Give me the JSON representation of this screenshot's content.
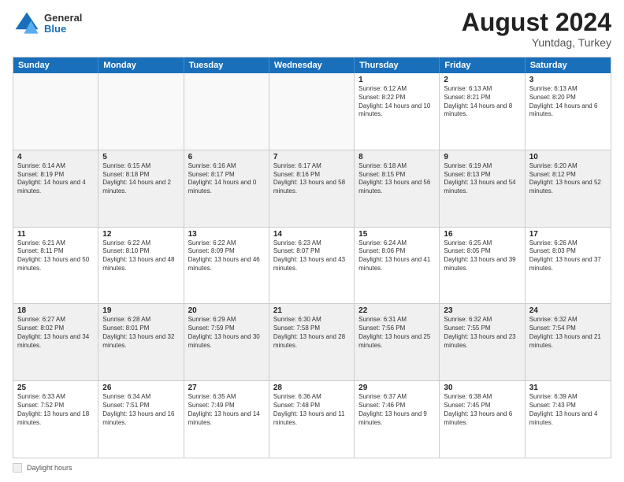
{
  "logo": {
    "general": "General",
    "blue": "Blue"
  },
  "header": {
    "month_year": "August 2024",
    "location": "Yuntdag, Turkey"
  },
  "day_headers": [
    "Sunday",
    "Monday",
    "Tuesday",
    "Wednesday",
    "Thursday",
    "Friday",
    "Saturday"
  ],
  "weeks": [
    [
      {
        "date": "",
        "info": "",
        "empty": true
      },
      {
        "date": "",
        "info": "",
        "empty": true
      },
      {
        "date": "",
        "info": "",
        "empty": true
      },
      {
        "date": "",
        "info": "",
        "empty": true
      },
      {
        "date": "1",
        "info": "Sunrise: 6:12 AM\nSunset: 8:22 PM\nDaylight: 14 hours and 10 minutes.",
        "empty": false
      },
      {
        "date": "2",
        "info": "Sunrise: 6:13 AM\nSunset: 8:21 PM\nDaylight: 14 hours and 8 minutes.",
        "empty": false
      },
      {
        "date": "3",
        "info": "Sunrise: 6:13 AM\nSunset: 8:20 PM\nDaylight: 14 hours and 6 minutes.",
        "empty": false
      }
    ],
    [
      {
        "date": "4",
        "info": "Sunrise: 6:14 AM\nSunset: 8:19 PM\nDaylight: 14 hours and 4 minutes.",
        "empty": false,
        "shaded": true
      },
      {
        "date": "5",
        "info": "Sunrise: 6:15 AM\nSunset: 8:18 PM\nDaylight: 14 hours and 2 minutes.",
        "empty": false,
        "shaded": true
      },
      {
        "date": "6",
        "info": "Sunrise: 6:16 AM\nSunset: 8:17 PM\nDaylight: 14 hours and 0 minutes.",
        "empty": false,
        "shaded": true
      },
      {
        "date": "7",
        "info": "Sunrise: 6:17 AM\nSunset: 8:16 PM\nDaylight: 13 hours and 58 minutes.",
        "empty": false,
        "shaded": true
      },
      {
        "date": "8",
        "info": "Sunrise: 6:18 AM\nSunset: 8:15 PM\nDaylight: 13 hours and 56 minutes.",
        "empty": false,
        "shaded": true
      },
      {
        "date": "9",
        "info": "Sunrise: 6:19 AM\nSunset: 8:13 PM\nDaylight: 13 hours and 54 minutes.",
        "empty": false,
        "shaded": true
      },
      {
        "date": "10",
        "info": "Sunrise: 6:20 AM\nSunset: 8:12 PM\nDaylight: 13 hours and 52 minutes.",
        "empty": false,
        "shaded": true
      }
    ],
    [
      {
        "date": "11",
        "info": "Sunrise: 6:21 AM\nSunset: 8:11 PM\nDaylight: 13 hours and 50 minutes.",
        "empty": false
      },
      {
        "date": "12",
        "info": "Sunrise: 6:22 AM\nSunset: 8:10 PM\nDaylight: 13 hours and 48 minutes.",
        "empty": false
      },
      {
        "date": "13",
        "info": "Sunrise: 6:22 AM\nSunset: 8:09 PM\nDaylight: 13 hours and 46 minutes.",
        "empty": false
      },
      {
        "date": "14",
        "info": "Sunrise: 6:23 AM\nSunset: 8:07 PM\nDaylight: 13 hours and 43 minutes.",
        "empty": false
      },
      {
        "date": "15",
        "info": "Sunrise: 6:24 AM\nSunset: 8:06 PM\nDaylight: 13 hours and 41 minutes.",
        "empty": false
      },
      {
        "date": "16",
        "info": "Sunrise: 6:25 AM\nSunset: 8:05 PM\nDaylight: 13 hours and 39 minutes.",
        "empty": false
      },
      {
        "date": "17",
        "info": "Sunrise: 6:26 AM\nSunset: 8:03 PM\nDaylight: 13 hours and 37 minutes.",
        "empty": false
      }
    ],
    [
      {
        "date": "18",
        "info": "Sunrise: 6:27 AM\nSunset: 8:02 PM\nDaylight: 13 hours and 34 minutes.",
        "empty": false,
        "shaded": true
      },
      {
        "date": "19",
        "info": "Sunrise: 6:28 AM\nSunset: 8:01 PM\nDaylight: 13 hours and 32 minutes.",
        "empty": false,
        "shaded": true
      },
      {
        "date": "20",
        "info": "Sunrise: 6:29 AM\nSunset: 7:59 PM\nDaylight: 13 hours and 30 minutes.",
        "empty": false,
        "shaded": true
      },
      {
        "date": "21",
        "info": "Sunrise: 6:30 AM\nSunset: 7:58 PM\nDaylight: 13 hours and 28 minutes.",
        "empty": false,
        "shaded": true
      },
      {
        "date": "22",
        "info": "Sunrise: 6:31 AM\nSunset: 7:56 PM\nDaylight: 13 hours and 25 minutes.",
        "empty": false,
        "shaded": true
      },
      {
        "date": "23",
        "info": "Sunrise: 6:32 AM\nSunset: 7:55 PM\nDaylight: 13 hours and 23 minutes.",
        "empty": false,
        "shaded": true
      },
      {
        "date": "24",
        "info": "Sunrise: 6:32 AM\nSunset: 7:54 PM\nDaylight: 13 hours and 21 minutes.",
        "empty": false,
        "shaded": true
      }
    ],
    [
      {
        "date": "25",
        "info": "Sunrise: 6:33 AM\nSunset: 7:52 PM\nDaylight: 13 hours and 18 minutes.",
        "empty": false
      },
      {
        "date": "26",
        "info": "Sunrise: 6:34 AM\nSunset: 7:51 PM\nDaylight: 13 hours and 16 minutes.",
        "empty": false
      },
      {
        "date": "27",
        "info": "Sunrise: 6:35 AM\nSunset: 7:49 PM\nDaylight: 13 hours and 14 minutes.",
        "empty": false
      },
      {
        "date": "28",
        "info": "Sunrise: 6:36 AM\nSunset: 7:48 PM\nDaylight: 13 hours and 11 minutes.",
        "empty": false
      },
      {
        "date": "29",
        "info": "Sunrise: 6:37 AM\nSunset: 7:46 PM\nDaylight: 13 hours and 9 minutes.",
        "empty": false
      },
      {
        "date": "30",
        "info": "Sunrise: 6:38 AM\nSunset: 7:45 PM\nDaylight: 13 hours and 6 minutes.",
        "empty": false
      },
      {
        "date": "31",
        "info": "Sunrise: 6:39 AM\nSunset: 7:43 PM\nDaylight: 13 hours and 4 minutes.",
        "empty": false
      }
    ]
  ],
  "legend": {
    "box_label": "Daylight hours"
  }
}
